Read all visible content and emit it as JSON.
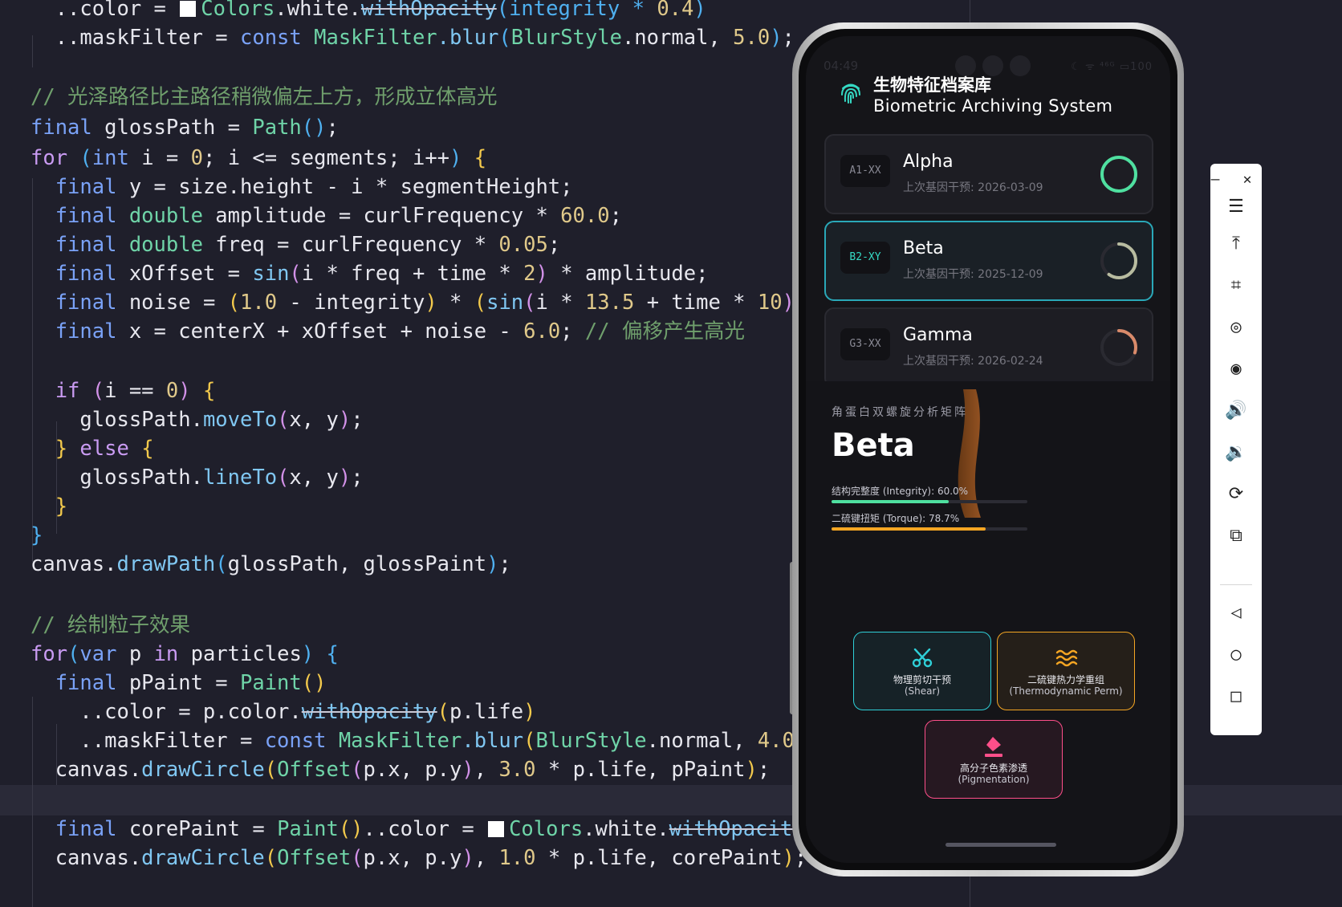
{
  "code_lines": [
    {
      "id": "c0",
      "tokens": [
        {
          "t": "  ..color = ",
          "c": ""
        },
        {
          "t": "SW",
          "c": "sw"
        },
        {
          "t": "Colors",
          "c": "ty"
        },
        {
          "t": ".white.",
          "c": ""
        },
        {
          "t": "withOpacity",
          "c": "fn dep"
        },
        {
          "t": "(integrity * ",
          "c": "br3"
        },
        {
          "t": "0.4",
          "c": "num"
        },
        {
          "t": ")",
          "c": "br3"
        }
      ]
    },
    {
      "id": "c1",
      "tokens": [
        {
          "t": "  ..maskFilter = ",
          "c": ""
        },
        {
          "t": "const ",
          "c": "kw"
        },
        {
          "t": "MaskFilter",
          "c": "ty"
        },
        {
          "t": ".blur",
          "c": "fn"
        },
        {
          "t": "(",
          "c": "br3"
        },
        {
          "t": "BlurStyle",
          "c": "ty"
        },
        {
          "t": ".normal, ",
          "c": ""
        },
        {
          "t": "5.0",
          "c": "num"
        },
        {
          "t": ")",
          "c": "br3"
        },
        {
          "t": ";",
          "c": ""
        }
      ]
    },
    {
      "id": "c2",
      "tokens": []
    },
    {
      "id": "c3",
      "tokens": [
        {
          "t": "// 光泽路径比主路径稍微偏左上方，形成立体高光",
          "c": "cm"
        }
      ]
    },
    {
      "id": "c4",
      "tokens": [
        {
          "t": "final ",
          "c": "kw"
        },
        {
          "t": "glossPath = ",
          "c": ""
        },
        {
          "t": "Path",
          "c": "ty"
        },
        {
          "t": "()",
          "c": "br3"
        },
        {
          "t": ";",
          "c": ""
        }
      ]
    },
    {
      "id": "c5",
      "tokens": [
        {
          "t": "for ",
          "c": "kw2"
        },
        {
          "t": "(",
          "c": "br3"
        },
        {
          "t": "int ",
          "c": "kw"
        },
        {
          "t": "i = ",
          "c": ""
        },
        {
          "t": "0",
          "c": "num"
        },
        {
          "t": "; i <= segments; i++",
          "c": ""
        },
        {
          "t": ")",
          "c": "br3"
        },
        {
          "t": " {",
          "c": "br1"
        }
      ]
    },
    {
      "id": "c6",
      "tokens": [
        {
          "t": "  final ",
          "c": "kw"
        },
        {
          "t": "y = size.height - i * segmentHeight;",
          "c": ""
        }
      ]
    },
    {
      "id": "c7",
      "tokens": [
        {
          "t": "  final ",
          "c": "kw"
        },
        {
          "t": "double ",
          "c": "ty"
        },
        {
          "t": "amplitude = curlFrequency * ",
          "c": ""
        },
        {
          "t": "60.0",
          "c": "num"
        },
        {
          "t": ";",
          "c": ""
        }
      ]
    },
    {
      "id": "c8",
      "tokens": [
        {
          "t": "  final ",
          "c": "kw"
        },
        {
          "t": "double ",
          "c": "ty"
        },
        {
          "t": "freq = curlFrequency * ",
          "c": ""
        },
        {
          "t": "0.05",
          "c": "num"
        },
        {
          "t": ";",
          "c": ""
        }
      ]
    },
    {
      "id": "c9",
      "tokens": [
        {
          "t": "  final ",
          "c": "kw"
        },
        {
          "t": "xOffset = ",
          "c": ""
        },
        {
          "t": "sin",
          "c": "fn"
        },
        {
          "t": "(",
          "c": "br2"
        },
        {
          "t": "i * freq + time * ",
          "c": ""
        },
        {
          "t": "2",
          "c": "num"
        },
        {
          "t": ")",
          "c": "br2"
        },
        {
          "t": " * amplitude;",
          "c": ""
        }
      ]
    },
    {
      "id": "c10",
      "tokens": [
        {
          "t": "  final ",
          "c": "kw"
        },
        {
          "t": "noise = ",
          "c": ""
        },
        {
          "t": "(",
          "c": "br1"
        },
        {
          "t": "1.0",
          "c": "num"
        },
        {
          "t": " - integrity",
          "c": ""
        },
        {
          "t": ")",
          "c": "br1"
        },
        {
          "t": " * ",
          "c": ""
        },
        {
          "t": "(",
          "c": "br1"
        },
        {
          "t": "sin",
          "c": "fn"
        },
        {
          "t": "(",
          "c": "br2"
        },
        {
          "t": "i * ",
          "c": ""
        },
        {
          "t": "13.5",
          "c": "num"
        },
        {
          "t": " + time * ",
          "c": ""
        },
        {
          "t": "10",
          "c": "num"
        },
        {
          "t": ")",
          "c": "br2"
        }
      ]
    },
    {
      "id": "c11",
      "tokens": [
        {
          "t": "  final ",
          "c": "kw"
        },
        {
          "t": "x = centerX + xOffset + noise - ",
          "c": ""
        },
        {
          "t": "6.0",
          "c": "num"
        },
        {
          "t": "; ",
          "c": ""
        },
        {
          "t": "// 偏移产生高光",
          "c": "cm"
        }
      ]
    },
    {
      "id": "c12",
      "tokens": []
    },
    {
      "id": "c13",
      "tokens": [
        {
          "t": "  if ",
          "c": "kw2"
        },
        {
          "t": "(",
          "c": "br2"
        },
        {
          "t": "i == ",
          "c": ""
        },
        {
          "t": "0",
          "c": "num"
        },
        {
          "t": ")",
          "c": "br2"
        },
        {
          "t": " {",
          "c": "br1"
        }
      ]
    },
    {
      "id": "c14",
      "tokens": [
        {
          "t": "    glossPath.",
          "c": ""
        },
        {
          "t": "moveTo",
          "c": "fn"
        },
        {
          "t": "(",
          "c": "br2"
        },
        {
          "t": "x, y",
          "c": ""
        },
        {
          "t": ")",
          "c": "br2"
        },
        {
          "t": ";",
          "c": ""
        }
      ]
    },
    {
      "id": "c15",
      "tokens": [
        {
          "t": "  }",
          "c": "br1"
        },
        {
          "t": " else ",
          "c": "kw2"
        },
        {
          "t": "{",
          "c": "br1"
        }
      ]
    },
    {
      "id": "c16",
      "tokens": [
        {
          "t": "    glossPath.",
          "c": ""
        },
        {
          "t": "lineTo",
          "c": "fn"
        },
        {
          "t": "(",
          "c": "br2"
        },
        {
          "t": "x, y",
          "c": ""
        },
        {
          "t": ")",
          "c": "br2"
        },
        {
          "t": ";",
          "c": ""
        }
      ]
    },
    {
      "id": "c17",
      "tokens": [
        {
          "t": "  }",
          "c": "br1"
        }
      ]
    },
    {
      "id": "c18",
      "tokens": [
        {
          "t": "}",
          "c": "br3"
        }
      ]
    },
    {
      "id": "c19",
      "tokens": [
        {
          "t": "canvas.",
          "c": ""
        },
        {
          "t": "drawPath",
          "c": "fn"
        },
        {
          "t": "(",
          "c": "br3"
        },
        {
          "t": "glossPath, glossPaint",
          "c": ""
        },
        {
          "t": ")",
          "c": "br3"
        },
        {
          "t": ";",
          "c": ""
        }
      ]
    },
    {
      "id": "c20",
      "tokens": []
    },
    {
      "id": "c21",
      "tokens": [
        {
          "t": "// 绘制粒子效果",
          "c": "cm"
        }
      ]
    },
    {
      "id": "c22",
      "tokens": [
        {
          "t": "for",
          "c": "kw2"
        },
        {
          "t": "(",
          "c": "br3"
        },
        {
          "t": "var ",
          "c": "kw"
        },
        {
          "t": "p ",
          "c": ""
        },
        {
          "t": "in ",
          "c": "kw2"
        },
        {
          "t": "particles",
          "c": ""
        },
        {
          "t": ")",
          "c": "br3"
        },
        {
          "t": " {",
          "c": "br3"
        }
      ]
    },
    {
      "id": "c23",
      "tokens": [
        {
          "t": "  final ",
          "c": "kw"
        },
        {
          "t": "pPaint = ",
          "c": ""
        },
        {
          "t": "Paint",
          "c": "ty"
        },
        {
          "t": "()",
          "c": "br1"
        }
      ]
    },
    {
      "id": "c24",
      "tokens": [
        {
          "t": "    ..color = p.color.",
          "c": ""
        },
        {
          "t": "withOpacity",
          "c": "fn dep"
        },
        {
          "t": "(",
          "c": "br1"
        },
        {
          "t": "p.life",
          "c": ""
        },
        {
          "t": ")",
          "c": "br1"
        }
      ]
    },
    {
      "id": "c25",
      "tokens": [
        {
          "t": "    ..maskFilter = ",
          "c": ""
        },
        {
          "t": "const ",
          "c": "kw"
        },
        {
          "t": "MaskFilter",
          "c": "ty"
        },
        {
          "t": ".blur",
          "c": "fn"
        },
        {
          "t": "(",
          "c": "br1"
        },
        {
          "t": "BlurStyle",
          "c": "ty"
        },
        {
          "t": ".normal, ",
          "c": ""
        },
        {
          "t": "4.0",
          "c": "num"
        }
      ]
    },
    {
      "id": "c26",
      "tokens": [
        {
          "t": "  canvas.",
          "c": ""
        },
        {
          "t": "drawCircle",
          "c": "fn"
        },
        {
          "t": "(",
          "c": "br1"
        },
        {
          "t": "Offset",
          "c": "ty"
        },
        {
          "t": "(",
          "c": "br2"
        },
        {
          "t": "p.x, p.y",
          "c": ""
        },
        {
          "t": ")",
          "c": "br2"
        },
        {
          "t": ", ",
          "c": ""
        },
        {
          "t": "3.0",
          "c": "num"
        },
        {
          "t": " * p.life, pPaint",
          "c": ""
        },
        {
          "t": ")",
          "c": "br1"
        },
        {
          "t": ";",
          "c": ""
        }
      ]
    },
    {
      "id": "c27",
      "tokens": []
    },
    {
      "id": "c28",
      "tokens": [
        {
          "t": "  final ",
          "c": "kw"
        },
        {
          "t": "corePaint = ",
          "c": ""
        },
        {
          "t": "Paint",
          "c": "ty"
        },
        {
          "t": "()",
          "c": "br1"
        },
        {
          "t": "..color = ",
          "c": ""
        },
        {
          "t": "SW",
          "c": "sw"
        },
        {
          "t": "Colors",
          "c": "ty"
        },
        {
          "t": ".white.",
          "c": ""
        },
        {
          "t": "withOpacity",
          "c": "fn dep"
        }
      ]
    },
    {
      "id": "c29",
      "tokens": [
        {
          "t": "  canvas.",
          "c": ""
        },
        {
          "t": "drawCircle",
          "c": "fn"
        },
        {
          "t": "(",
          "c": "br1"
        },
        {
          "t": "Offset",
          "c": "ty"
        },
        {
          "t": "(",
          "c": "br2"
        },
        {
          "t": "p.x, p.y",
          "c": ""
        },
        {
          "t": ")",
          "c": "br2"
        },
        {
          "t": ", ",
          "c": ""
        },
        {
          "t": "1.0",
          "c": "num"
        },
        {
          "t": " * p.life, corePaint",
          "c": ""
        },
        {
          "t": ")",
          "c": "br1"
        },
        {
          "t": ";",
          "c": ""
        }
      ]
    }
  ],
  "phone": {
    "status_time": "04:49",
    "status_right": "☾ ᯤ ⁴⁶ᴳ ▭100",
    "title_cn": "生物特征档案库",
    "title_en": "Biometric Archiving System",
    "cards": [
      {
        "code": "A1-XX",
        "name": "Alpha",
        "date": "上次基因干预: 2026-03-09",
        "ring_color": "#4fe0a0",
        "progress": 1.0
      },
      {
        "code": "B2-XY",
        "name": "Beta",
        "date": "上次基因干预: 2025-12-09",
        "ring_color": "#b8bca0",
        "progress": 0.6
      },
      {
        "code": "G3-XX",
        "name": "Gamma",
        "date": "上次基因干预: 2026-02-24",
        "ring_color": "#d98a6a",
        "progress": 0.3
      }
    ],
    "panel": {
      "subtitle": "角蛋白双螺旋分析矩阵",
      "title": "Beta",
      "integrity_label": "结构完整度 (Integrity): 60.0%",
      "integrity_value": 0.6,
      "integrity_color": "#4fe0a0",
      "torque_label": "二硫键扭矩 (Torque): 78.7%",
      "torque_value": 0.787,
      "torque_color": "#f5a623"
    },
    "controls": [
      {
        "icon": "scissors-icon",
        "l1": "物理剪切干预",
        "l2": "(Shear)",
        "color": "#2fd0d8"
      },
      {
        "icon": "waves-icon",
        "l1": "二硫键热力学重组",
        "l2": "(Thermodynamic Perm)",
        "color": "#f5a623"
      },
      {
        "icon": "paint-bucket-icon",
        "l1": "高分子色素渗透",
        "l2": "(Pigmentation)",
        "color": "#ff4f8a"
      }
    ]
  },
  "toolbar": {
    "items": [
      {
        "name": "menu-icon",
        "glyph": "☰"
      },
      {
        "name": "pin-top-icon",
        "glyph": "⤒"
      },
      {
        "name": "crop-icon",
        "glyph": "⌗"
      },
      {
        "name": "rotate-left-icon",
        "glyph": "◎"
      },
      {
        "name": "rotate-right-icon",
        "glyph": "◉"
      },
      {
        "name": "volume-up-icon",
        "glyph": "🔊"
      },
      {
        "name": "volume-down-icon",
        "glyph": "🔉"
      },
      {
        "name": "rotate-device-icon",
        "glyph": "⟳"
      },
      {
        "name": "screenshot-icon",
        "glyph": "⧉"
      },
      {
        "name": "back-icon",
        "glyph": "◁"
      },
      {
        "name": "home-icon",
        "glyph": "○"
      },
      {
        "name": "overview-icon",
        "glyph": "□"
      }
    ],
    "minimize": "–",
    "close": "✕"
  }
}
